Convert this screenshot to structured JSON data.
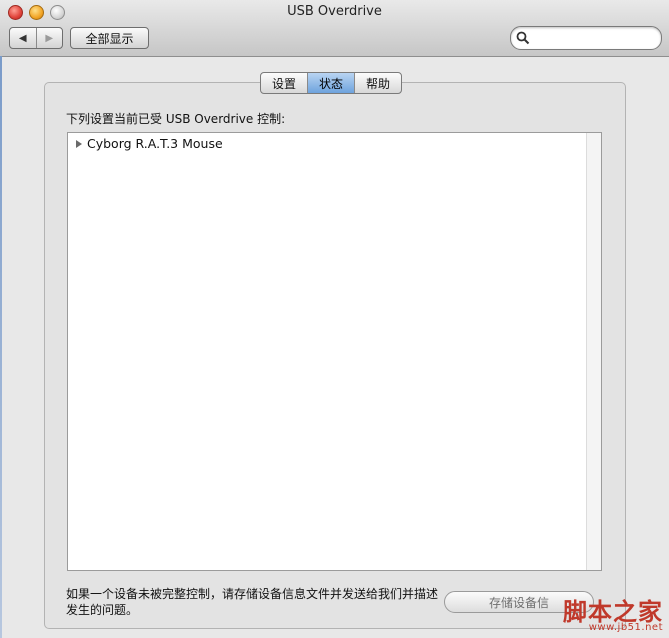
{
  "window": {
    "title": "USB Overdrive"
  },
  "toolbar": {
    "back_icon": "◀",
    "forward_icon": "▶",
    "show_all_label": "全部显示",
    "search_placeholder": ""
  },
  "tabs": [
    {
      "label": "设置",
      "active": false
    },
    {
      "label": "状态",
      "active": true
    },
    {
      "label": "帮助",
      "active": false
    }
  ],
  "panel": {
    "intro_label": "下列设置当前已受 USB Overdrive 控制:",
    "devices": [
      {
        "name": "Cyborg R.A.T.3 Mouse",
        "expanded": false
      }
    ],
    "footer_text": "如果一个设备未被完整控制，请存储设备信息文件并发送给我们并描述发生的问题。",
    "save_button_label": "存储设备信"
  },
  "watermark": {
    "logo_text": "脚本之家",
    "url_text": "www.jb51.net"
  },
  "colors": {
    "tab_active": "#6ea3de",
    "watermark_red": "#c0392b"
  }
}
